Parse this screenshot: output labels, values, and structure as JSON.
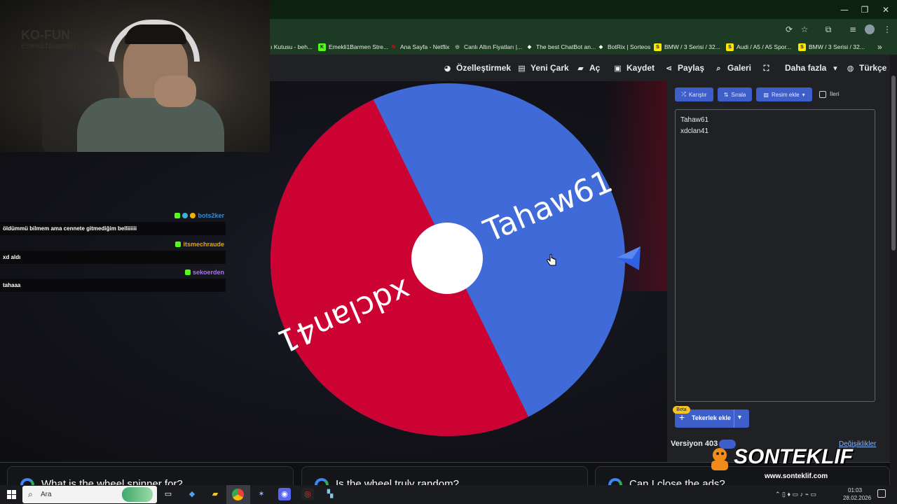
{
  "window": {
    "controls": {
      "minimize": "—",
      "restore": "❐",
      "close": "✕"
    }
  },
  "bookmarks": [
    {
      "label": "ı Kutusu - beh...",
      "icon_color": "#1d3a24",
      "letter": ""
    },
    {
      "label": "Emekli1Barmen Stre...",
      "icon_color": "#53fc18",
      "letter": "K"
    },
    {
      "label": "Ana Sayfa - Netflix",
      "icon_color": "#e50914",
      "letter": "N"
    },
    {
      "label": "Canlı Altın Fiyatları |...",
      "icon_color": "#c0c0c0",
      "letter": "◎"
    },
    {
      "label": "The best ChatBot an...",
      "icon_color": "#ffffff",
      "letter": "◆"
    },
    {
      "label": "BotRix | Sorteos",
      "icon_color": "#ffffff",
      "letter": "◆"
    },
    {
      "label": "BMW / 3 Serisi / 32...",
      "icon_color": "#ffe800",
      "letter": "S"
    },
    {
      "label": "Audi / A5 / A5 Spor...",
      "icon_color": "#ffe800",
      "letter": "S"
    },
    {
      "label": "BMW / 3 Serisi / 32...",
      "icon_color": "#ffe800",
      "letter": "S"
    }
  ],
  "bookmarks_more": "»",
  "nav": {
    "customize": "Özelleştirmek",
    "new_wheel": "Yeni Çark",
    "open": "Aç",
    "save": "Kaydet",
    "share": "Paylaş",
    "gallery": "Galeri",
    "more": "Daha fazla",
    "language": "Türkçe"
  },
  "wheel": {
    "entries": [
      "Tahaw61",
      "xdclan41"
    ],
    "colors": {
      "blue": "#3f6ad8",
      "red": "#cc0233",
      "hub": "#ffffff"
    }
  },
  "panel": {
    "shuffle": "Karıştır",
    "sort": "Sırala",
    "add_image": "Resim ekle",
    "advanced": "İleri",
    "entries": [
      "Tahaw61",
      "xdclan41"
    ],
    "beta": "Beta",
    "add_wheel": "Tekerlek ekle",
    "version": "Versiyon 403",
    "changes": "Değişiklikler"
  },
  "chat": [
    {
      "user": "bots2ker",
      "user_color": "#2f8fd8",
      "message": "öldümmü bilmem ama cennete gitmediğim belliiiiii"
    },
    {
      "user": "itsmechraude",
      "user_color": "#e6a600",
      "message": "xd aldı"
    },
    {
      "user": "sekoerden",
      "user_color": "#a970ff",
      "message": "tahaaa"
    }
  ],
  "cam_overlay": {
    "logo": "KO-FUN",
    "sub": "Emekli1Barmen"
  },
  "faq": [
    "What is the wheel spinner for?",
    "Is the wheel truly random?",
    "Can I close the ads?"
  ],
  "branding": {
    "name": "SONTEKLIF",
    "url": "www.sonteklif.com"
  },
  "taskbar": {
    "search_placeholder": "Ara",
    "time": "01:03",
    "date": "28.02.2026"
  }
}
